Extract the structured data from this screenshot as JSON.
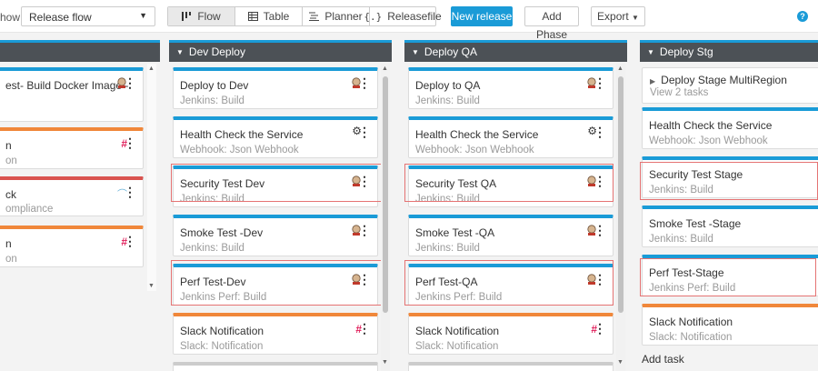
{
  "toolbar": {
    "show_label": "how",
    "template_select": "Release flow",
    "views": [
      "Flow",
      "Table",
      "Planner",
      "Releasefile"
    ],
    "new_release": "New release",
    "add_phase": "Add Phase",
    "export": "Export",
    "help": "?"
  },
  "phases": [
    {
      "name": "",
      "cards": [
        {
          "title": "est- Build Docker Image -",
          "sub": "",
          "icon": "jenkins-icon",
          "color": "blue"
        },
        {
          "title": "n",
          "sub": "on",
          "icon": "slack-icon",
          "color": "orange"
        },
        {
          "title": "ck",
          "sub": "ompliance",
          "icon": "compliance-icon",
          "color": "red"
        },
        {
          "title": "n",
          "sub": "on",
          "icon": "slack-icon",
          "color": "orange"
        }
      ]
    },
    {
      "name": "Dev Deploy",
      "cards": [
        {
          "title": "Deploy to Dev",
          "sub": "Jenkins: Build",
          "icon": "jenkins-icon",
          "color": "blue"
        },
        {
          "title": "Health Check the Service",
          "sub": "Webhook: Json Webhook",
          "icon": "gear-icon",
          "color": "blue"
        },
        {
          "title": "Security Test Dev",
          "sub": "Jenkins: Build",
          "icon": "jenkins-icon",
          "color": "blue"
        },
        {
          "title": "Smoke Test -Dev",
          "sub": "Jenkins: Build",
          "icon": "jenkins-icon",
          "color": "blue"
        },
        {
          "title": "Perf Test-Dev",
          "sub": "Jenkins Perf: Build",
          "icon": "jenkins-icon",
          "color": "blue"
        },
        {
          "title": "Slack Notification",
          "sub": "Slack: Notification",
          "icon": "slack-icon",
          "color": "orange"
        }
      ]
    },
    {
      "name": "Deploy QA",
      "cards": [
        {
          "title": "Deploy to QA",
          "sub": "Jenkins: Build",
          "icon": "jenkins-icon",
          "color": "blue"
        },
        {
          "title": "Health Check the Service",
          "sub": "Webhook: Json Webhook",
          "icon": "gear-icon",
          "color": "blue"
        },
        {
          "title": "Security Test QA",
          "sub": "Jenkins: Build",
          "icon": "jenkins-icon",
          "color": "blue"
        },
        {
          "title": "Smoke Test -QA",
          "sub": "Jenkins: Build",
          "icon": "jenkins-icon",
          "color": "blue"
        },
        {
          "title": "Perf Test-QA",
          "sub": "Jenkins Perf: Build",
          "icon": "jenkins-icon",
          "color": "blue"
        },
        {
          "title": "Slack Notification",
          "sub": "Slack: Notification",
          "icon": "slack-icon",
          "color": "orange"
        }
      ]
    },
    {
      "name": "Deploy Stg",
      "group": {
        "title": "Deploy Stage MultiRegion",
        "sub": "View 2 tasks"
      },
      "cards": [
        {
          "title": "Health Check the Service",
          "sub": "Webhook: Json Webhook",
          "icon": "",
          "color": "blue"
        },
        {
          "title": "Security Test Stage",
          "sub": "Jenkins: Build",
          "icon": "",
          "color": "blue"
        },
        {
          "title": "Smoke Test -Stage",
          "sub": "Jenkins: Build",
          "icon": "",
          "color": "blue"
        },
        {
          "title": "Perf Test-Stage",
          "sub": "Jenkins Perf: Build",
          "icon": "",
          "color": "blue"
        },
        {
          "title": "Slack Notification",
          "sub": "Slack: Notification",
          "icon": "",
          "color": "orange"
        }
      ],
      "add_task": "Add task"
    }
  ],
  "colors": {
    "accent": "#1a9bd7",
    "header": "#4c5156",
    "orange": "#f0873a",
    "red": "#d9534f",
    "highlight": "#e57373"
  }
}
